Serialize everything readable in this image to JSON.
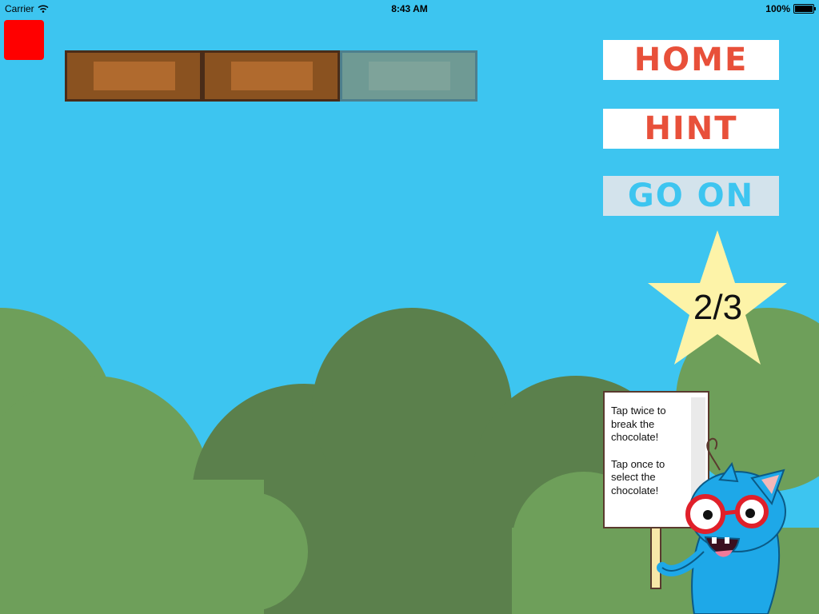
{
  "status_bar": {
    "carrier": "Carrier",
    "time": "8:43 AM",
    "battery": "100%"
  },
  "menu": {
    "home_label": "HOME",
    "hint_label": "HINT",
    "go_on_label": "GO ON"
  },
  "progress": {
    "text": "2/3",
    "current": 2,
    "total": 3
  },
  "chocolate_pieces": [
    {
      "state": "selected"
    },
    {
      "state": "selected"
    },
    {
      "state": "unselected"
    }
  ],
  "sign": {
    "line1": "Tap twice to break the chocolate!",
    "line2": "Tap once to select the chocolate!"
  },
  "colors": {
    "sky": "#3dc5f0",
    "hill_light": "#6e9f5a",
    "hill_dark": "#5b804c",
    "button_text": "#e8503a",
    "star": "#fdf3a8",
    "chocolate": "#8a5220",
    "chocolate_inner": "#b06a2e",
    "mascot": "#1ea8e8"
  }
}
